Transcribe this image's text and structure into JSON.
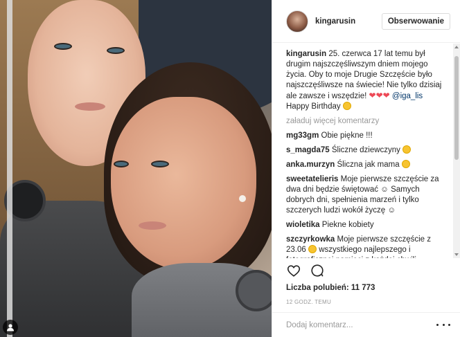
{
  "post": {
    "username": "kingarusin",
    "follow_label": "Obserwowanie",
    "caption_user": "kingarusin",
    "caption_text": "25. czerwca 17 lat temu był drugim najszczęśliwszym dniem mojego życia. Oby to moje Drugie Szczęście było najszczęśliwsze na świecie! Nie tylko dzisiaj ale zawsze i wszędzie!",
    "caption_mention": "@iga_lis",
    "caption_end": "Happy Birthday",
    "load_more": "załaduj więcej komentarzy",
    "comments": [
      {
        "user": "mg33gm",
        "text": "Obie piękne !!!"
      },
      {
        "user": "s_magda75",
        "text": "Śliczne dziewczyny"
      },
      {
        "user": "anka.murzyn",
        "text": "Śliczna jak mama"
      },
      {
        "user": "sweetatelieris",
        "text": "Moje pierwsze szczęście za dwa dni będzie świętować ☺ Samych dobrych dni, spełnienia marzeń i tylko szczerych ludzi wokół życzę ☺"
      },
      {
        "user": "wioletika",
        "text": "Piekne kobiety"
      },
      {
        "user": "szczyrkowka",
        "text": "Moje pierwsze szczęście z 23.06"
      },
      {
        "user": "",
        "text": "wszystkiego najlepszego i fotograficznej pamięci z każdej chwili"
      }
    ],
    "likes": "Liczba polubień: 11 773",
    "time": "12 GODZ. TEMU",
    "comment_placeholder": "Dodaj komentarz..."
  },
  "colors": {
    "accent_link": "#003569",
    "heart": "#ed4956",
    "muted": "#999999"
  },
  "icons": {
    "like": "heart-icon",
    "comment": "comment-icon",
    "more": "more-icon",
    "tag": "user-tag-icon"
  }
}
